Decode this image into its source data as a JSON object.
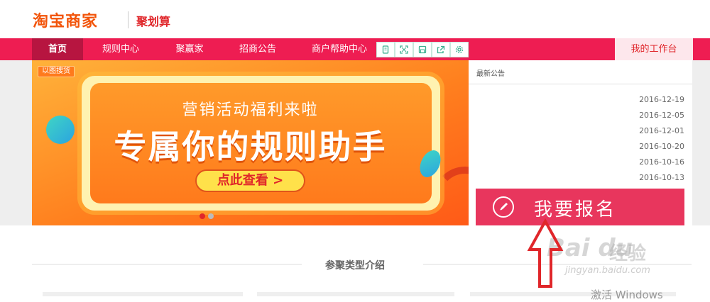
{
  "header": {
    "logo_main": "淘宝商家",
    "logo_sub": "聚划算"
  },
  "nav": {
    "items": [
      {
        "label": "首页",
        "active": true
      },
      {
        "label": "规则中心"
      },
      {
        "label": "聚赢家"
      },
      {
        "label": "招商公告"
      },
      {
        "label": "商户帮助中心"
      }
    ],
    "tools": [
      "document-icon",
      "expand-icon",
      "save-icon",
      "export-icon",
      "settings-icon"
    ],
    "workbench_label": "我的工作台"
  },
  "banner": {
    "tag": "以图搜货",
    "subtitle": "营销活动福利来啦",
    "title": "专属你的规则助手",
    "cta": "点此查看 >"
  },
  "notice": {
    "title": "最新公告",
    "dates": [
      "2016-12-19",
      "2016-12-05",
      "2016-12-01",
      "2016-10-20",
      "2016-10-16",
      "2016-10-13"
    ]
  },
  "signup": {
    "label": "我要报名",
    "icon": "compass-icon"
  },
  "section": {
    "title": "参聚类型介绍"
  },
  "watermark": {
    "brand": "Bai du",
    "suffix": "经验",
    "url": "jingyan.baidu.com"
  },
  "os": {
    "activate": "激活 Windows"
  },
  "colors": {
    "nav": "#ee1d52",
    "nav_active": "#b71540",
    "signup": "#e8365d",
    "arrow": "#e0262a"
  }
}
